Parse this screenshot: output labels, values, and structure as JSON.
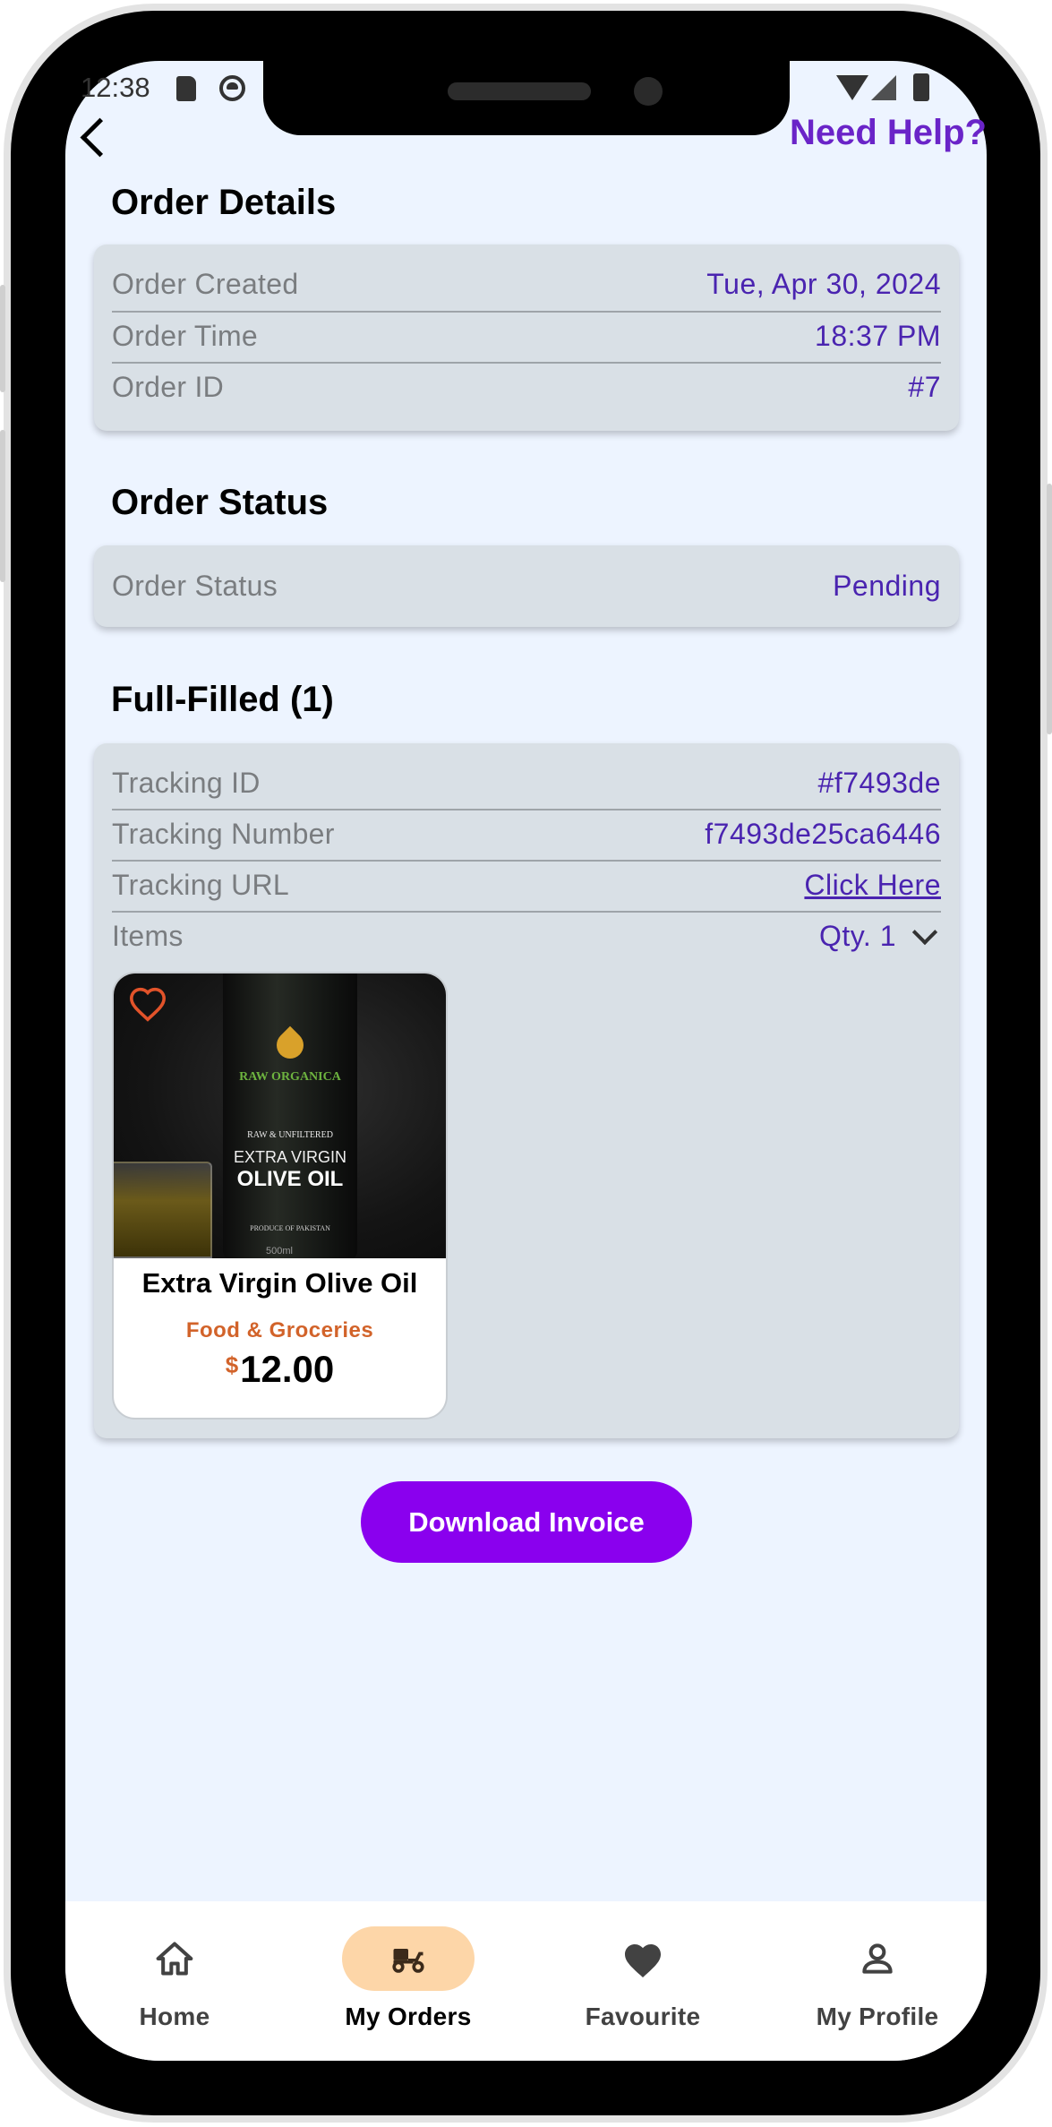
{
  "status_bar": {
    "time": "12:38"
  },
  "header": {
    "back_label": "",
    "help_label": "Need Help?"
  },
  "order_details": {
    "title": "Order Details",
    "rows": [
      {
        "label": "Order Created",
        "value": "Tue, Apr 30, 2024"
      },
      {
        "label": "Order Time",
        "value": "18:37 PM"
      },
      {
        "label": "Order ID",
        "value": "#7"
      }
    ]
  },
  "order_status": {
    "title": "Order Status",
    "label": "Order Status",
    "value": "Pending"
  },
  "fulfilled": {
    "title": "Full-Filled (1)",
    "tracking_id_label": "Tracking ID",
    "tracking_id_value": "#f7493de",
    "tracking_number_label": "Tracking Number",
    "tracking_number_value": "f7493de25ca6446",
    "tracking_url_label": "Tracking URL",
    "tracking_url_value": "Click Here",
    "items_label": "Items",
    "qty_label": "Qty. 1"
  },
  "product": {
    "image_text": {
      "brand": "RAW ORGANICA",
      "band": "RAW & UNFILTERED",
      "line1": "EXTRA VIRGIN",
      "line2": "OLIVE OIL",
      "origin": "PRODUCE OF PAKISTAN",
      "volume": "500ml"
    },
    "name": "Extra Virgin Olive Oil",
    "category": "Food & Groceries",
    "currency": "$",
    "price": "12.00"
  },
  "actions": {
    "download_invoice": "Download Invoice"
  },
  "bottom_nav": {
    "items": [
      {
        "label": "Home",
        "icon": "home-icon"
      },
      {
        "label": "My Orders",
        "icon": "delivery-scooter-icon",
        "active": true
      },
      {
        "label": "Favourite",
        "icon": "heart-icon"
      },
      {
        "label": "My Profile",
        "icon": "person-icon"
      }
    ]
  },
  "colors": {
    "accent_purple": "#8a00ee",
    "value_purple": "#4a24b0",
    "category_orange": "#d2632a",
    "active_nav_pill": "#fdd6a8",
    "screen_bg": "#edf4ff",
    "card_bg": "#d9e0e6"
  }
}
